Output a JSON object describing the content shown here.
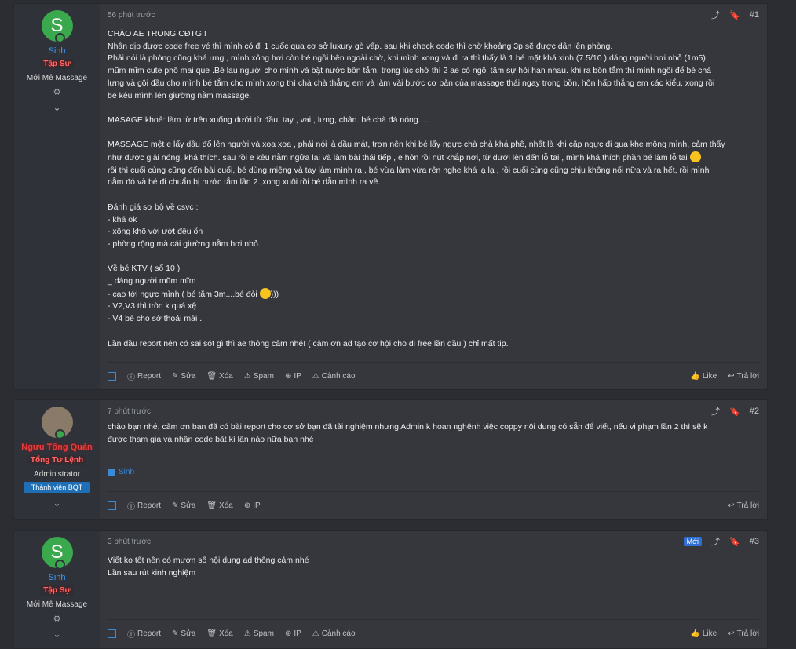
{
  "posts": [
    {
      "user": {
        "name": "Sinh",
        "avatar_letter": "S",
        "rank": "Tập Sự",
        "title": "Mới Mê Massage"
      },
      "time": "56 phút trước",
      "number": "#1",
      "body": "CHÀO AE TRONG CĐTG !\nNhân dịp được code free vé thì mình có đi 1 cuốc qua cơ sở luxury gò vấp. sau khi check code thì chờ khoảng 3p sẽ được dẫn lên phòng.\nPhải nói là phòng cũng khá ưng , mình xông hơi còn bé ngồi bên ngoài chờ, khi mình xong và đi ra thì thấy là 1 bé mặt khá xinh (7.5/10 ) dáng người hơi nhỏ (1m5),\nmũm mĩm cute phô mai que .Bé lau người cho mình và bật nước bồn tắm. trong lúc chờ thì 2 ae có ngồi tâm sự hỏi han nhau. khi ra bồn tắm thì mình ngồi để bé chà\nlưng và gội đầu cho mình bé tắm cho mình xong thì chà chà thẳng em và làm vài bước cơ bản của massage thái ngay trong bồn, hôn hấp thẳng em các kiểu. xong rồi\nbé kêu mình lên giường nằm massage.\n\nMASAGE khoẻ: làm từ trên xuống dưới từ đầu, tay , vai , lưng, chân. bé chà đá nóng.....\n\nMASSAGE mệt e lấy dầu đổ lên người và xoa xoa , phải nói là dầu mát, trơn nên khi bé lấy ngực chà chà khá phê, nhất là khi cặp ngực đi qua khe mông mình, cảm thấy\nnhư được giải nóng, khá thích. sau rồi e kêu nằm ngửa lại và làm bài thái tiếp , e hôn rồi nút khắp nơi, từ dưới lên đến lỗ tai , mình khá thích phần bé làm lỗ tai",
      "body2": "rồi thì cuối cùng cũng đến bài cuối, bé dùng miệng và tay làm mình ra , bé vừa làm vừa rên nghe khá lạ lạ , rồi cuối cùng cũng chịu không nổi nữa và ra hết, rồi mình\nnằm đó và bé đi chuẩn bị nước tắm lần 2.,xong xuôi rồi bé dẫn mình ra về.\n\nĐánh giá sơ bộ về csvc :\n- khá ok\n- xông khô với ướt đều ổn\n- phòng rộng mà cái giường nằm hơi nhỏ.\n\nVề bé KTV ( số 10 )\n_ dáng người mũm mĩm\n- cao tới ngực mình ( bé tắm 3m....bé đòi",
      "body2_tail": ")))",
      "body3": "- V2,V3 thì tròn k quá xệ\n- V4 bé cho sờ thoải mái .\n\nLần đầu report nên có sai sót gì thì ae thông cảm nhé! ( cảm ơn ad tạo cơ hội cho đi free lần đầu ) chỉ mất tip.",
      "actions": [
        "Report",
        "Sửa",
        "Xóa",
        "Spam",
        "IP",
        "Cảnh cáo"
      ],
      "right_actions": [
        "Like",
        "Trả lời"
      ]
    },
    {
      "user": {
        "name": "Ngưu Tổng Quản",
        "rank": "Tổng Tư Lệnh",
        "title": "Administrator",
        "badge": "Thành viên BQT"
      },
      "time": "7 phút trước",
      "number": "#2",
      "body": "chào bạn nhé, cảm ơn bạn đã có bài report cho cơ sở bạn đã tải nghiệm nhưng Admin k hoan nghênh việc coppy nội dung có sẵn để viết, nếu vi phạm lần 2 thì sẽ k\nđược tham gia và nhận code bất kì lần nào nữa bạn nhé",
      "reaction": "Sinh",
      "actions": [
        "Report",
        "Sửa",
        "Xóa",
        "IP"
      ],
      "right_actions": [
        "Trả lời"
      ]
    },
    {
      "user": {
        "name": "Sinh",
        "avatar_letter": "S",
        "rank": "Tập Sự",
        "title": "Mới Mê Massage"
      },
      "time": "3 phút trước",
      "number": "#3",
      "new_label": "Mới",
      "body": "Viết ko tốt nên có mượn sổ nội dung ad thông cảm nhé\nLần sau rút kinh nghiệm",
      "actions": [
        "Report",
        "Sửa",
        "Xóa",
        "Spam",
        "IP",
        "Cảnh cáo"
      ],
      "right_actions": [
        "Like",
        "Trả lời"
      ]
    }
  ]
}
